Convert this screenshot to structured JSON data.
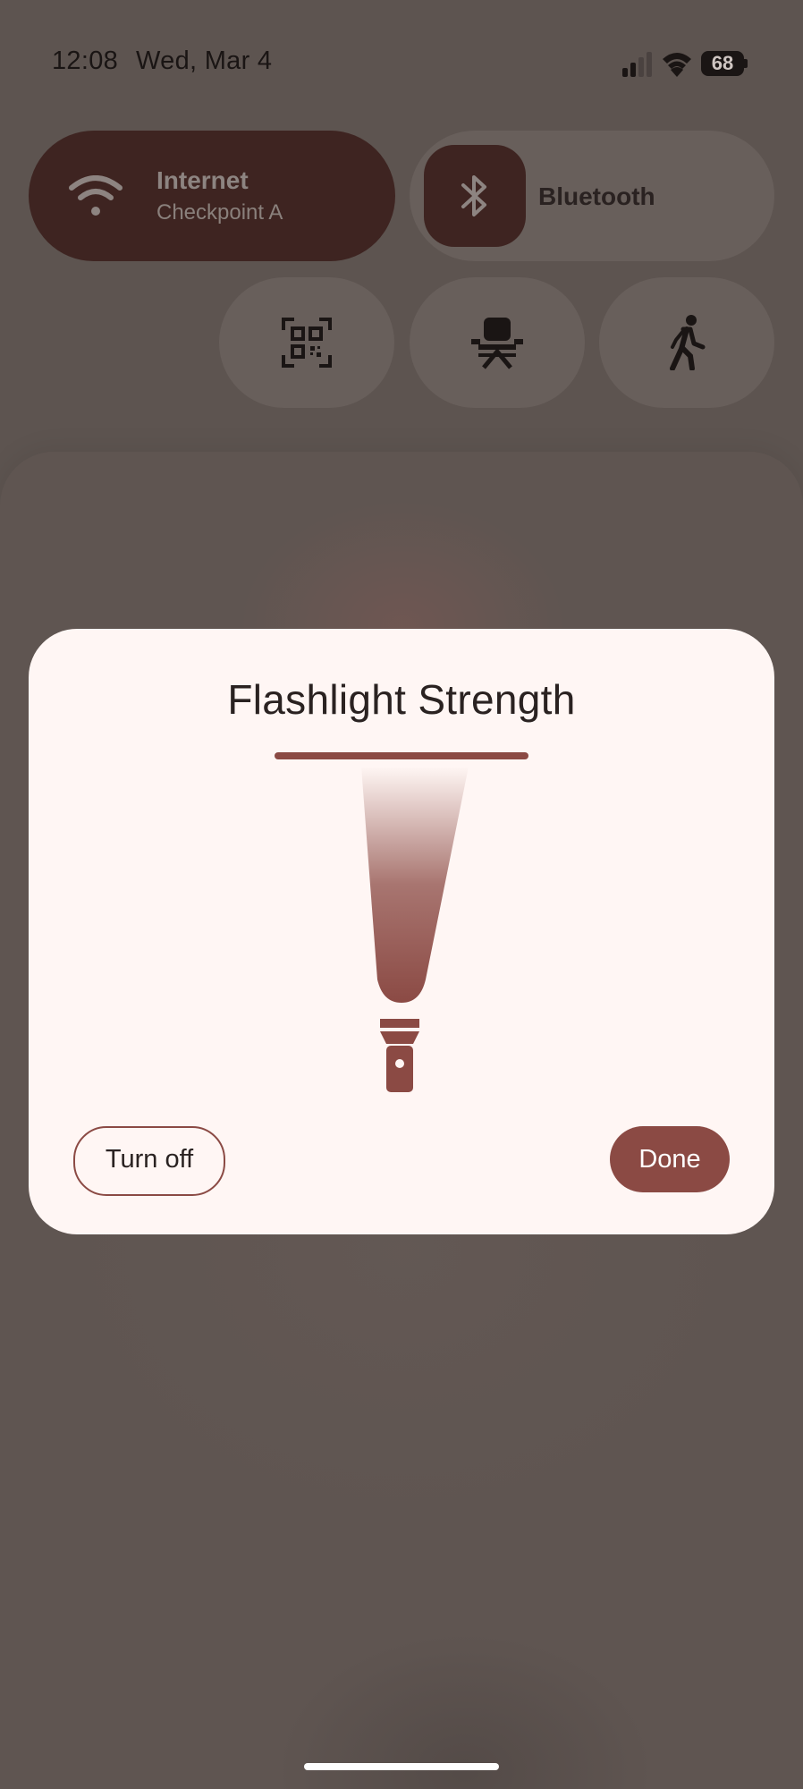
{
  "status_bar": {
    "time": "12:08",
    "date": "Wed, Mar 4",
    "battery_level": "68",
    "icons": [
      "signal-icon",
      "wifi-icon",
      "battery-icon"
    ]
  },
  "tiles": {
    "internet": {
      "title": "Internet",
      "subtitle": "Checkpoint A",
      "icon": "wifi-icon",
      "active": true
    },
    "bluetooth": {
      "title": "Bluetooth",
      "icon": "bluetooth-icon",
      "active": true
    },
    "small": [
      {
        "icon": "qr-code-scanner-icon"
      },
      {
        "icon": "desk-chair-icon"
      },
      {
        "icon": "walking-person-icon"
      }
    ]
  },
  "dialog": {
    "title": "Flashlight Strength",
    "strength_level": 1.0,
    "turn_off_label": "Turn off",
    "done_label": "Done"
  },
  "colors": {
    "accent": "#8b4a44",
    "tile_active": "#3e2421",
    "dialog_bg": "#fff6f4",
    "scrim": "#5d5450"
  }
}
